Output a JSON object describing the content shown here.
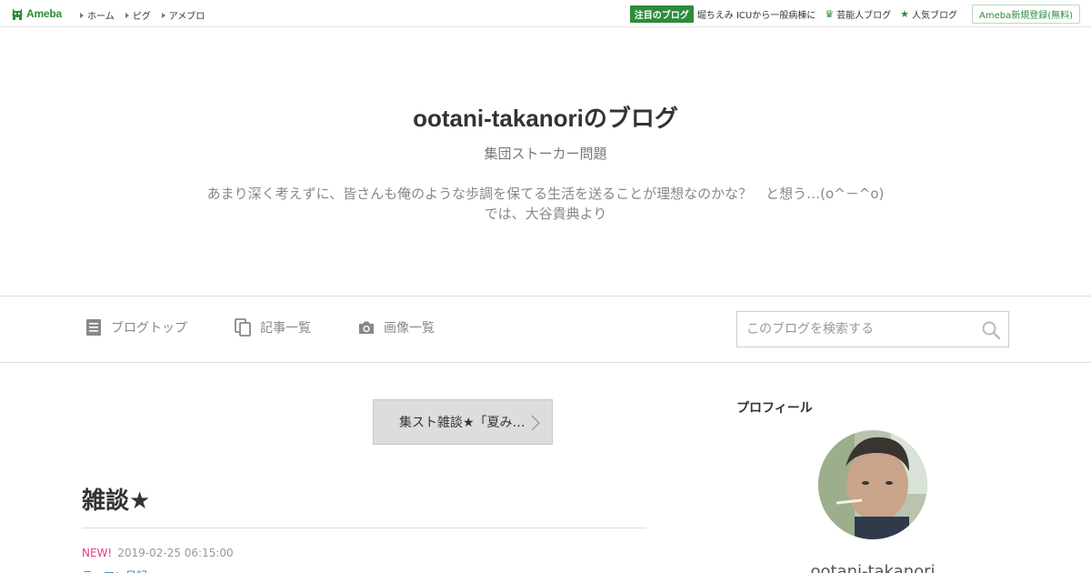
{
  "topbar": {
    "logo_text": "Ameba",
    "nav": [
      "ホーム",
      "ピグ",
      "アメブロ"
    ],
    "focus_badge": "注目のブログ",
    "focus_link": "堀ちえみ ICUから一般病棟に",
    "celebrity_link": "芸能人ブログ",
    "popular_link": "人気ブログ",
    "signup": "Ameba新規登録(無料)",
    "accent_color": "#2d8c3c"
  },
  "header": {
    "title": "ootani-takanoriのブログ",
    "subtitle": "集団ストーカー問題",
    "description_line1": "あまり深く考えずに、皆さんも俺のような歩調を保てる生活を送ることが理想なのかな？　と想う…(o^－^o)",
    "description_line2": "では、大谷貴典より"
  },
  "navbar": {
    "items": [
      {
        "label": "ブログトップ",
        "icon": "document-icon"
      },
      {
        "label": "記事一覧",
        "icon": "copy-icon"
      },
      {
        "label": "画像一覧",
        "icon": "camera-icon"
      }
    ],
    "search_placeholder": "このブログを検索する"
  },
  "main": {
    "prev_link": "集スト雑談★「夏み…",
    "entry_title": "雑談★",
    "new_label": "NEW!",
    "date": "2019-02-25 06:15:00",
    "theme": "テーマ：日記"
  },
  "sidebar": {
    "heading": "プロフィール",
    "name": "ootani-takanori"
  }
}
